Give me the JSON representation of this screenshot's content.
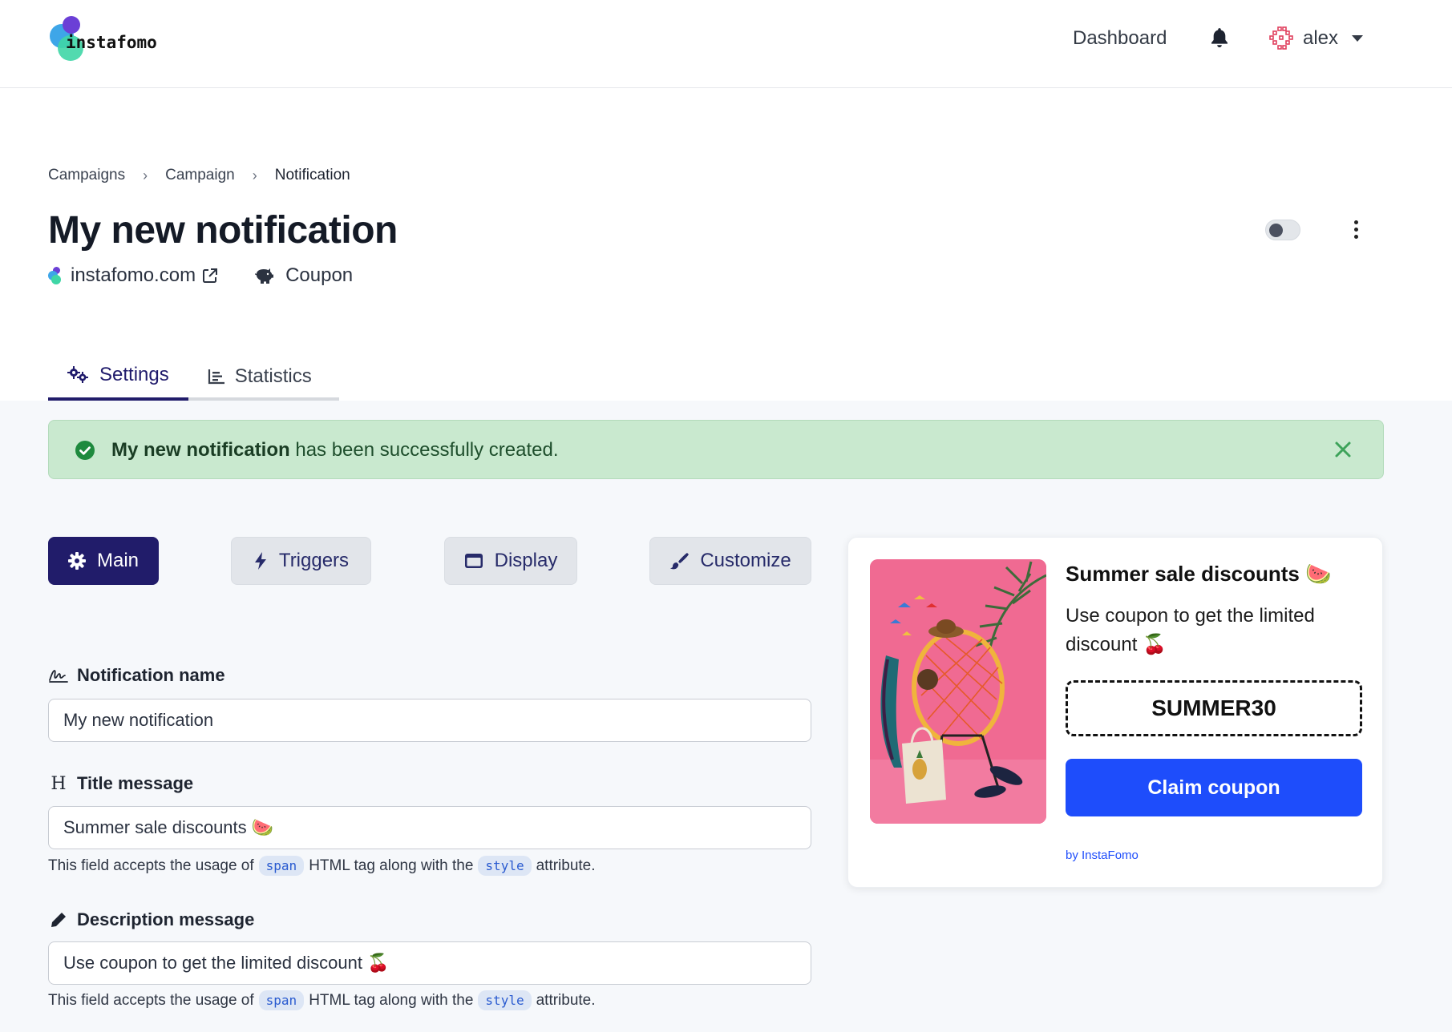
{
  "navbar": {
    "logo_text": "instafomo",
    "dashboard_label": "Dashboard",
    "username": "alex"
  },
  "breadcrumb": {
    "items": [
      "Campaigns",
      "Campaign",
      "Notification"
    ]
  },
  "page": {
    "title": "My new notification",
    "site": "instafomo.com",
    "type": "Coupon"
  },
  "tabs": [
    {
      "label": "Settings",
      "active": true
    },
    {
      "label": "Statistics",
      "active": false
    }
  ],
  "alert": {
    "bold": "My new notification",
    "text": " has been successfully created."
  },
  "sections": [
    {
      "label": "Main",
      "icon": "gear-icon",
      "active": true
    },
    {
      "label": "Triggers",
      "icon": "bolt-icon",
      "active": false
    },
    {
      "label": "Display",
      "icon": "window-icon",
      "active": false
    },
    {
      "label": "Customize",
      "icon": "paintbrush-icon",
      "active": false
    }
  ],
  "form": {
    "name_label": "Notification name",
    "name_value": "My new notification",
    "title_label": "Title message",
    "title_value": "Summer sale discounts 🍉",
    "desc_label": "Description message",
    "desc_value": "Use coupon to get the limited discount 🍒",
    "help_pre": "This field accepts the usage of",
    "help_tag": "span",
    "help_mid": "HTML tag along with the",
    "help_attr": "style",
    "help_post": "attribute."
  },
  "preview": {
    "title": "Summer sale discounts 🍉",
    "description": "Use coupon to get the limited discount 🍒",
    "coupon_code": "SUMMER30",
    "button_label": "Claim coupon",
    "branding": "by InstaFomo"
  },
  "colors": {
    "primary": "#211c6a",
    "success_bg": "#c9e9cf",
    "preview_button": "#1e4dfb"
  }
}
